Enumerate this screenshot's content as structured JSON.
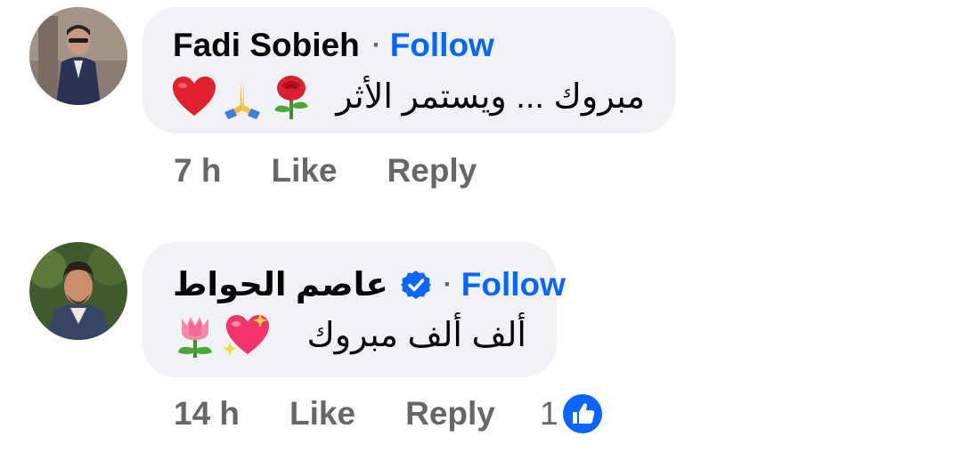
{
  "comments": [
    {
      "author": "Fadi Sobieh",
      "separator": "·",
      "follow_label": "Follow",
      "text": "مبروك ... ويستمر الأثر",
      "emojis": [
        "rose-icon",
        "praying-hands-icon",
        "red-heart-icon"
      ],
      "time": "7 h",
      "like_label": "Like",
      "reply_label": "Reply"
    },
    {
      "author": "عاصم الحواط",
      "verified": true,
      "separator": "·",
      "follow_label": "Follow",
      "text": "ألف ألف مبروك",
      "emojis": [
        "sparkling-heart-icon",
        "tulip-icon"
      ],
      "time": "14 h",
      "like_label": "Like",
      "reply_label": "Reply",
      "reaction_count": "1"
    }
  ],
  "colors": {
    "bubble_bg": "#f0f2f5",
    "follow_blue": "#0866ff",
    "meta_gray": "#65676b",
    "text": "#050505"
  }
}
